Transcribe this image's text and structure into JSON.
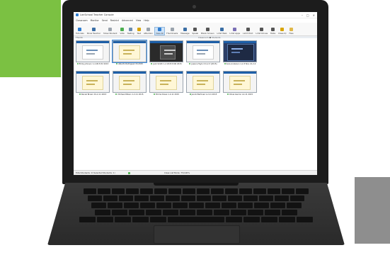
{
  "window": {
    "title": "LanSchool Teacher Console",
    "controls": [
      "–",
      "□",
      "×"
    ]
  },
  "menu": [
    "Classroom",
    "Monitor",
    "Send",
    "Restrict",
    "Advanced",
    "View",
    "Help"
  ],
  "toolbar": [
    {
      "label": "Tutorials",
      "icon": "info-icon",
      "color": "#2e7dd1"
    },
    {
      "label": "Show Teacher",
      "icon": "monitor-icon",
      "color": "#3a6ea5"
    },
    {
      "label": "Show Student",
      "icon": "screen-share-icon",
      "color": "#9aa3ad"
    },
    {
      "label": "Vote",
      "icon": "vote-icon",
      "color": "#4caf50"
    },
    {
      "label": "Testing",
      "icon": "test-icon",
      "color": "#6a8caf"
    },
    {
      "label": "Test",
      "icon": "pencil-icon",
      "color": "#d9a400"
    },
    {
      "label": "Attention",
      "icon": "attention-icon",
      "color": "#9aa3ad"
    },
    {
      "label": "View All",
      "icon": "grid-icon",
      "color": "#2e7dd1",
      "active": true
    },
    {
      "label": "Thumbnails",
      "icon": "thumbnail-icon",
      "color": "#9aa3ad"
    },
    {
      "label": "Message",
      "icon": "message-icon",
      "color": "#3a6ea5"
    },
    {
      "label": "Speak",
      "icon": "headset-icon",
      "color": "#555555"
    },
    {
      "label": "Blank Screen",
      "icon": "blank-screen-icon",
      "color": "#555555"
    },
    {
      "label": "Limit Web",
      "icon": "globe-icon",
      "color": "#3a6ea5"
    },
    {
      "label": "Limit Apps",
      "icon": "apps-icon",
      "color": "#7a6fb5"
    },
    {
      "label": "Limit Print",
      "icon": "printer-icon",
      "color": "#555555"
    },
    {
      "label": "Limit Drives",
      "icon": "drive-icon",
      "color": "#555555"
    },
    {
      "label": "Mute",
      "icon": "speaker-icon",
      "color": "#555555"
    },
    {
      "label": "Class IQ",
      "icon": "chart-icon",
      "color": "#d9a400"
    },
    {
      "label": "Files",
      "icon": "folder-icon",
      "color": "#e0b84a"
    }
  ],
  "tabs": {
    "left": "Thumb",
    "group": "Classroom ■ Students"
  },
  "students": [
    {
      "name": "Emily Johnson 1-2-09 8:32 2015",
      "screen": "web",
      "selected": false
    },
    {
      "name": "Alberto Rodriguez 15-2015",
      "screen": "doc",
      "selected": true
    },
    {
      "name": "Jack Smith 1-2 2015 8:00 2015",
      "screen": "dark",
      "selected": false
    },
    {
      "name": "Jessica Taylor 01-2-3 (2015)",
      "screen": "web",
      "selected": false
    },
    {
      "name": "Sara Anderson 1-2-3 Nov 21-2-4",
      "screen": "video",
      "selected": false
    },
    {
      "name": "Daniel Brown 01-2-11 2015",
      "screen": "doc",
      "selected": false
    },
    {
      "name": "Michael Wilson 1-2-11 2015",
      "screen": "doc",
      "selected": false
    },
    {
      "name": "Emma Davis 1-2-11 2015",
      "screen": "doc",
      "selected": false
    },
    {
      "name": "Jacob Martinez 1-2-11 2015",
      "screen": "doc",
      "selected": false
    },
    {
      "name": "Olivia Garcia 1-2-11 2015",
      "screen": "doc",
      "selected": false
    }
  ],
  "status": {
    "left": "Total Students: 9 (Selected Students: 1)",
    "center": "Class List Mode: 75/100%"
  }
}
